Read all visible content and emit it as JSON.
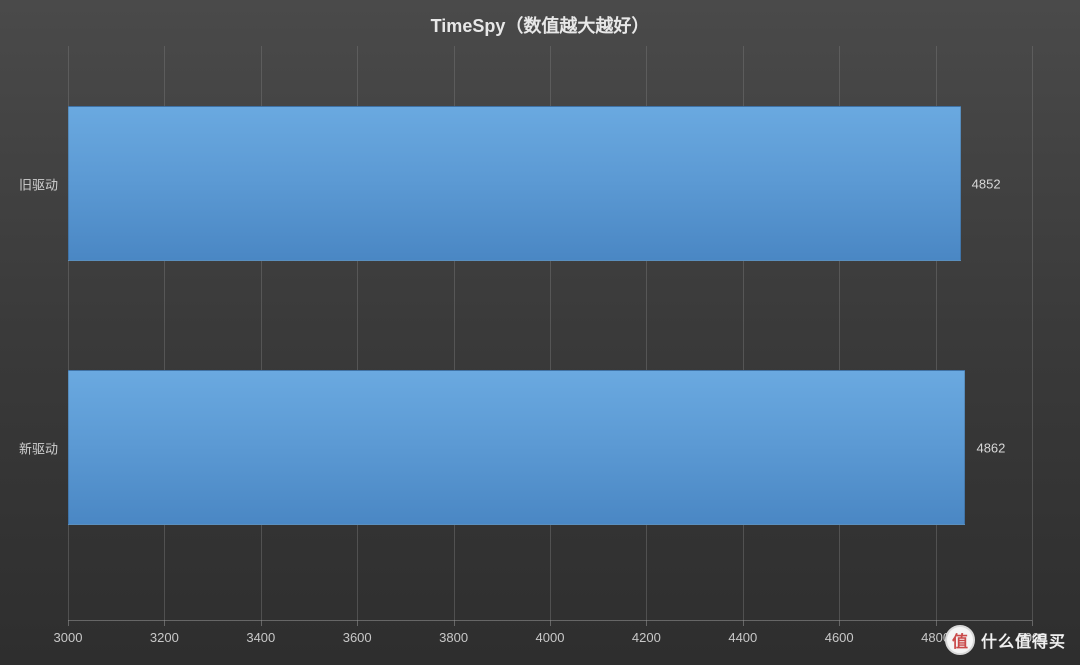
{
  "chart_data": {
    "type": "bar",
    "orientation": "horizontal",
    "title": "TimeSpy（数值越大越好）",
    "categories": [
      "旧驱动",
      "新驱动"
    ],
    "values": [
      4852,
      4862
    ],
    "xlim": [
      3000,
      5000
    ],
    "x_ticks": [
      3000,
      3200,
      3400,
      3600,
      3800,
      4000,
      4200,
      4400,
      4600,
      4800,
      5000
    ],
    "bar_color": "#5b99d3"
  },
  "watermark": {
    "badge": "值",
    "text": "什么值得买"
  }
}
